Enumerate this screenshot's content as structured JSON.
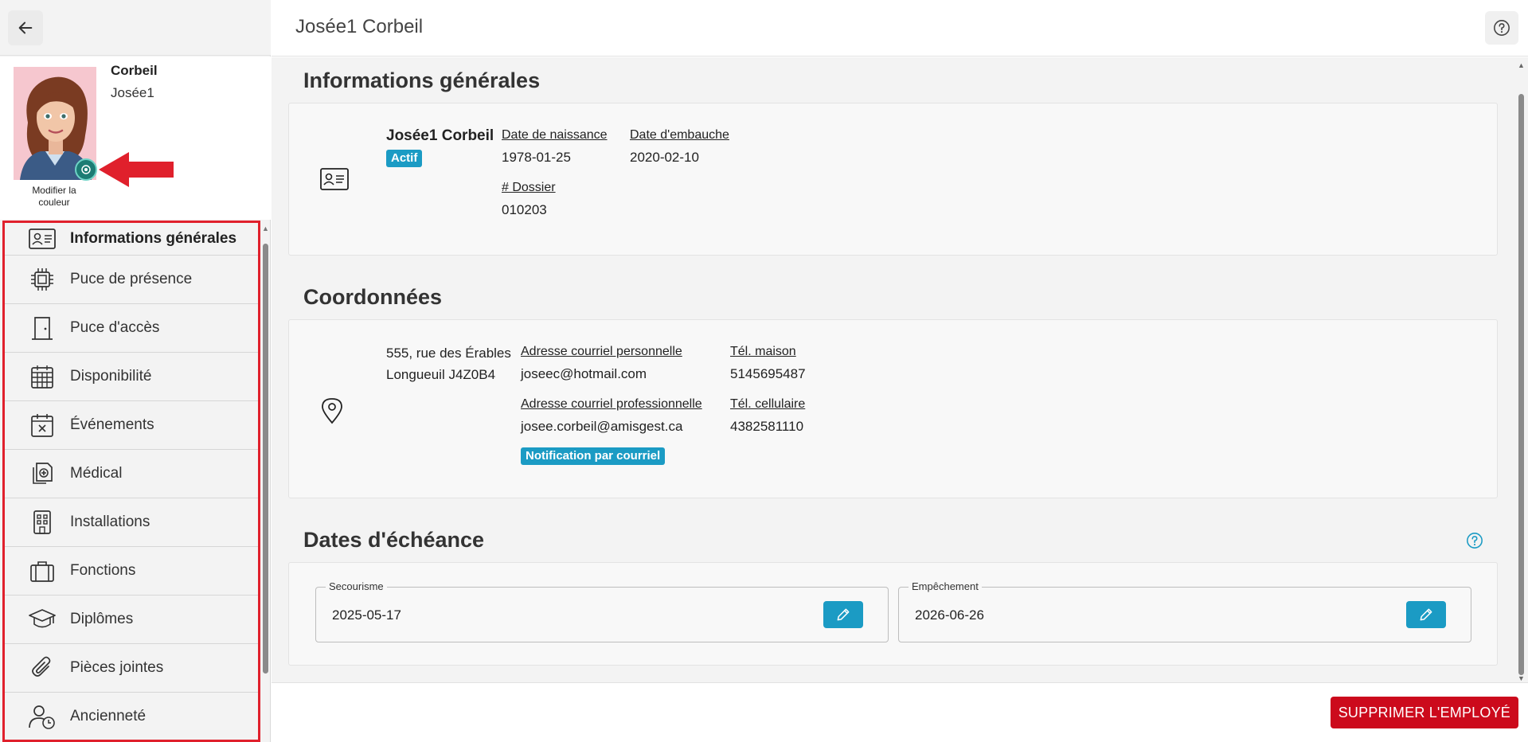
{
  "header": {
    "title": "Josée1 Corbeil"
  },
  "profile": {
    "last_name": "Corbeil",
    "first_name": "Josée1",
    "color_label": "Modifier la couleur"
  },
  "sidebar": {
    "items": [
      {
        "label": "Informations générales",
        "icon": "id-card-icon",
        "active": true
      },
      {
        "label": "Puce de présence",
        "icon": "chip-icon",
        "active": false
      },
      {
        "label": "Puce d'accès",
        "icon": "door-icon",
        "active": false
      },
      {
        "label": "Disponibilité",
        "icon": "calendar-grid-icon",
        "active": false
      },
      {
        "label": "Événements",
        "icon": "calendar-x-icon",
        "active": false
      },
      {
        "label": "Médical",
        "icon": "medical-docs-icon",
        "active": false
      },
      {
        "label": "Installations",
        "icon": "building-icon",
        "active": false
      },
      {
        "label": "Fonctions",
        "icon": "briefcase-icon",
        "active": false
      },
      {
        "label": "Diplômes",
        "icon": "graduation-cap-icon",
        "active": false
      },
      {
        "label": "Pièces jointes",
        "icon": "paperclip-icon",
        "active": false
      },
      {
        "label": "Ancienneté",
        "icon": "user-clock-icon",
        "active": false
      }
    ]
  },
  "general": {
    "title": "Informations générales",
    "full_name": "Josée1 Corbeil",
    "status": "Actif",
    "birth_label": "Date de naissance",
    "birth_value": "1978-01-25",
    "hire_label": "Date d'embauche",
    "hire_value": "2020-02-10",
    "file_label": "# Dossier",
    "file_value": "010203"
  },
  "contact": {
    "title": "Coordonnées",
    "address_line1": "555, rue des Érables",
    "address_line2": "Longueuil J4Z0B4",
    "personal_email_label": "Adresse courriel personnelle",
    "personal_email": "joseec@hotmail.com",
    "pro_email_label": "Adresse courriel professionnelle",
    "pro_email": "josee.corbeil@amisgest.ca",
    "notification_badge": "Notification par courriel",
    "home_phone_label": "Tél. maison",
    "home_phone": "5145695487",
    "cell_phone_label": "Tél. cellulaire",
    "cell_phone": "4382581110"
  },
  "due_dates": {
    "title": "Dates d'échéance",
    "first_aid_label": "Secourisme",
    "first_aid_value": "2025-05-17",
    "impediment_label": "Empêchement",
    "impediment_value": "2026-06-26"
  },
  "footer": {
    "delete_label": "SUPPRIMER L'EMPLOYÉ"
  },
  "colors": {
    "accent": "#1b9bc4",
    "danger": "#cc0a1c",
    "highlight": "#e0202c"
  }
}
